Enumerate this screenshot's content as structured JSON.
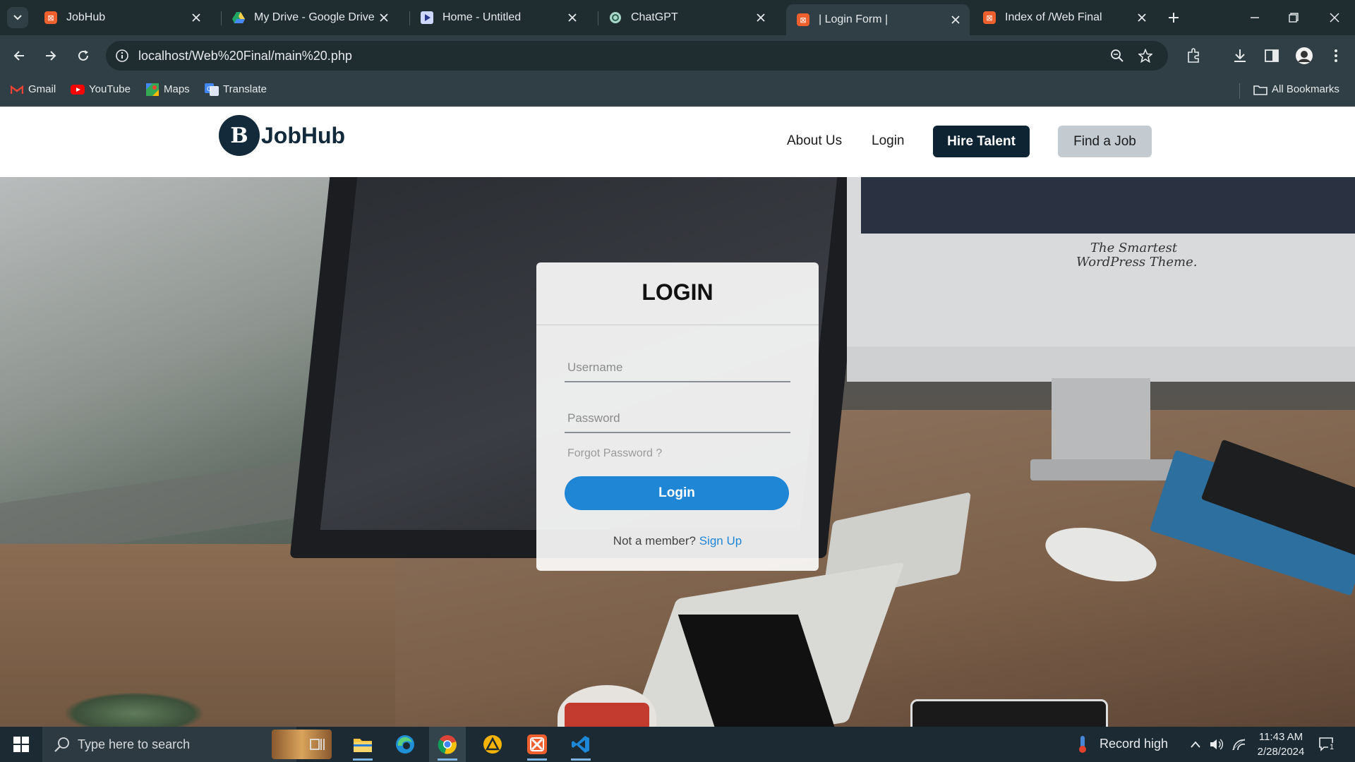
{
  "browser": {
    "tabs": [
      {
        "title": "JobHub",
        "icon": "xampp-icon",
        "active": false
      },
      {
        "title": "My Drive - Google Drive",
        "icon": "google-drive-icon",
        "active": false
      },
      {
        "title": "Home - Untitled",
        "icon": "play-icon",
        "active": false
      },
      {
        "title": "ChatGPT",
        "icon": "chatgpt-icon",
        "active": false
      },
      {
        "title": "| Login Form |",
        "icon": "xampp-icon",
        "active": true
      },
      {
        "title": "Index of /Web Final",
        "icon": "xampp-icon",
        "active": false
      }
    ],
    "url": "localhost/Web%20Final/main%20.php",
    "bookmarks": [
      {
        "label": "Gmail",
        "icon": "gmail-icon"
      },
      {
        "label": "YouTube",
        "icon": "youtube-icon"
      },
      {
        "label": "Maps",
        "icon": "maps-icon"
      },
      {
        "label": "Translate",
        "icon": "translate-icon"
      }
    ],
    "all_bookmarks": "All Bookmarks"
  },
  "site": {
    "brand": "JobHub",
    "logo_letter": "B",
    "nav": {
      "about": "About Us",
      "login": "Login",
      "hire": "Hire Talent",
      "find": "Find a Job"
    },
    "hero_screen_text": [
      "The Smartest",
      "WordPress Theme."
    ]
  },
  "login": {
    "title": "LOGIN",
    "username_placeholder": "Username",
    "password_placeholder": "Password",
    "forgot": "Forgot Password ?",
    "button": "Login",
    "member_text": "Not a member?",
    "signup": "Sign Up"
  },
  "taskbar": {
    "search_placeholder": "Type here to search",
    "weather": "Record high",
    "time": "11:43 AM",
    "date": "2/28/2024",
    "notifications": "1"
  },
  "colors": {
    "brand_dark": "#0e2433",
    "login_button": "#1f86d6",
    "find_button": "#c3cbd0"
  }
}
